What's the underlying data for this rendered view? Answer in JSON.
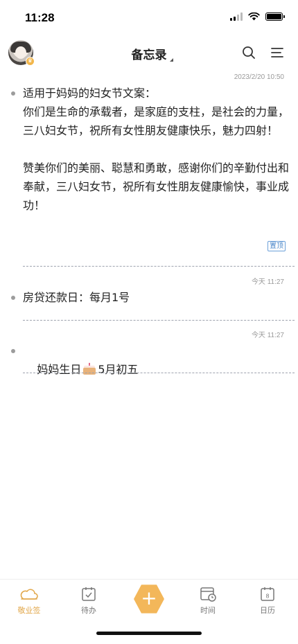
{
  "status_bar": {
    "time": "11:28"
  },
  "header": {
    "title": "备忘录"
  },
  "notes": [
    {
      "timestamp": "2023/2/20 10:50",
      "text": "适用于妈妈的妇女节文案：\n你们是生命的承载者，是家庭的支柱，是社会的力量，三八妇女节，祝所有女性朋友健康快乐，魅力四射！\n\n赞美你们的美丽、聪慧和勇敢，感谢你们的辛勤付出和奉献，三八妇女节，祝所有女性朋友健康愉快，事业成功！",
      "badge": "置顶"
    },
    {
      "timestamp": "今天 11:27",
      "text": "房贷还款日：每月1号"
    },
    {
      "timestamp": "今天 11:27",
      "text_before": "妈妈生日",
      "icon": "cake-icon",
      "text_after": "5月初五"
    }
  ],
  "tabbar": {
    "items": [
      {
        "label": "敬业签",
        "icon": "cloud-icon",
        "active": true
      },
      {
        "label": "待办",
        "icon": "calendar-check-icon",
        "active": false
      },
      {
        "label": "",
        "icon": "plus-icon",
        "active": false
      },
      {
        "label": "时间",
        "icon": "calendar-clock-icon",
        "active": false
      },
      {
        "label": "日历",
        "icon": "calendar-day-icon",
        "active": false
      }
    ]
  },
  "colors": {
    "accent": "#f3b75a",
    "active_tab": "#e2a84c",
    "divider": "#9ea3ae",
    "pin_badge": "#4a86c8"
  }
}
